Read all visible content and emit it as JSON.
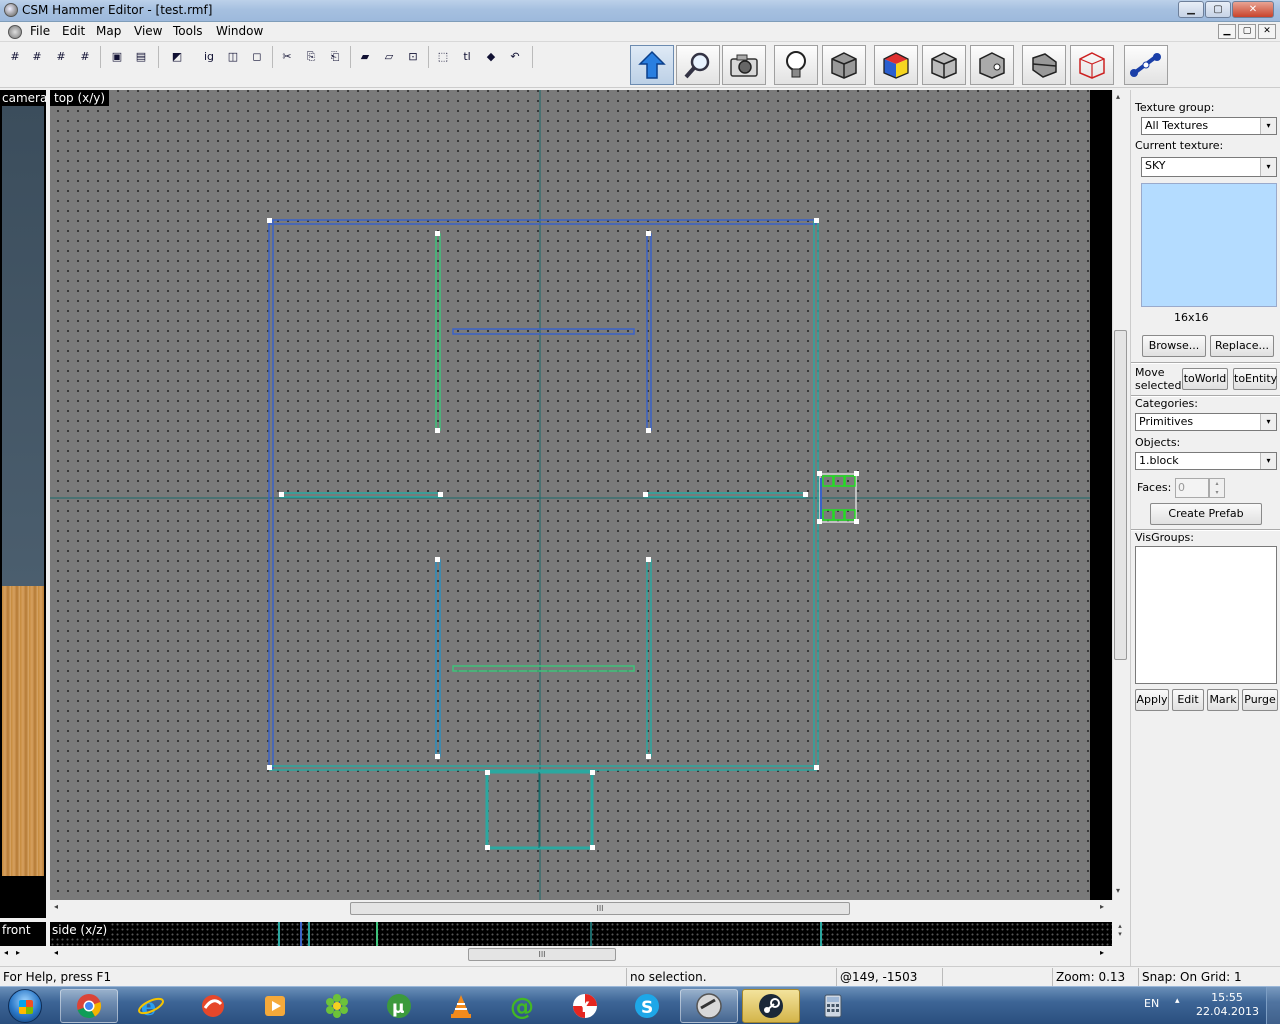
{
  "window": {
    "title": "CSM Hammer Editor - [test.rmf]",
    "min": "▁",
    "max": "▢",
    "close": "✕"
  },
  "menu": [
    "File",
    "Edit",
    "Map",
    "View",
    "Tools",
    "Window"
  ],
  "mdi": [
    "▁",
    "▢",
    "✕"
  ],
  "toolbar": {
    "small_icons": [
      "grid-toggle",
      "grid-3d",
      "grid-smaller",
      "grid-larger",
      "group",
      "ungroup",
      "entity-to-world",
      "texture-lock",
      "hide",
      "show",
      "cut",
      "copy",
      "paste",
      "texture-lock-2",
      "texture-scale-lock",
      "carve",
      "hollow",
      "transform",
      "flip",
      "undo"
    ],
    "small_glyphs": [
      "#",
      "#",
      "#",
      "#",
      "▣",
      "▤",
      "◩",
      "ig",
      "◫",
      "◻",
      "✂",
      "⎘",
      "⎗",
      "▰",
      "▱",
      "⊡",
      "⬚",
      "tl",
      "◆",
      "↶"
    ],
    "big_tools": [
      "selection-tool",
      "magnify-tool",
      "camera-tool",
      "entity-tool",
      "block-tool",
      "texture-tool",
      "apply-texture-tool",
      "decal-tool",
      "clip-tool",
      "vertex-tool",
      "path-tool"
    ]
  },
  "views": {
    "camera_label": "camera",
    "top_label": "top (x/y)",
    "front_label": "front",
    "side_label": "side (x/z)"
  },
  "scroll": {
    "grip": "III",
    "left": "◂",
    "right": "▸",
    "up": "▴",
    "down": "▾"
  },
  "panel": {
    "texture_group_label": "Texture group:",
    "texture_group_value": "All Textures",
    "current_texture_label": "Current texture:",
    "current_texture_value": "SKY",
    "texture_size": "16x16",
    "browse": "Browse...",
    "replace": "Replace...",
    "move_selected": "Move selected:",
    "to_world": "toWorld",
    "to_entity": "toEntity",
    "categories_label": "Categories:",
    "categories_value": "Primitives",
    "objects_label": "Objects:",
    "objects_value": "1.block",
    "faces_label": "Faces:",
    "faces_value": "0",
    "create_prefab": "Create Prefab",
    "visgroups_label": "VisGroups:",
    "apply": "Apply",
    "edit": "Edit",
    "mark": "Mark",
    "purge": "Purge",
    "dropdown_arrow": "▾",
    "spin_up": "▴",
    "spin_down": "▾"
  },
  "status": {
    "help": "For Help, press F1",
    "selection": "no selection.",
    "coords": "@149, -1503",
    "zoom": "Zoom: 0.13",
    "snap": "Snap: On Grid: 1"
  },
  "taskbar": {
    "apps": [
      "chrome",
      "internet-explorer",
      "fire-app",
      "media-player",
      "icq",
      "utorrent",
      "vlc",
      "mail-agent",
      "yandex-browser",
      "skype",
      "csm-hammer",
      "steam",
      "calculator"
    ],
    "lang": "EN",
    "tray_arrow": "▴",
    "time": "15:55",
    "date": "22.04.2013"
  },
  "colors": {
    "viewport_bg": "#7a7a7a",
    "brush_blue": "#3b62c8",
    "brush_teal": "#2aa8a0",
    "brush_green": "#3ec27a",
    "selected_green": "#22dd22",
    "texture_sky": "#b4dcff"
  }
}
